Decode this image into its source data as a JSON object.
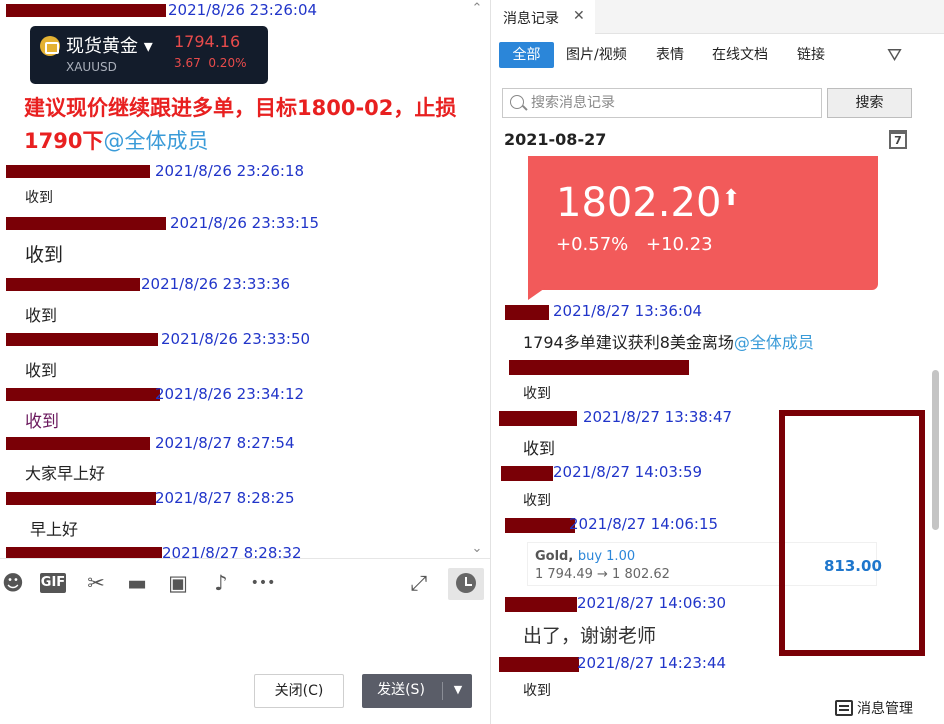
{
  "chat": {
    "timestamps": [
      "2021/8/26 23:26:04",
      "2021/8/26 23:26:18",
      "2021/8/26 23:33:15",
      "2021/8/26 23:33:36",
      "2021/8/26 23:33:50",
      "2021/8/26 23:34:12",
      "2021/8/27 8:27:54",
      "2021/8/27 8:28:25",
      "2021/8/27 8:28:32"
    ],
    "gold_card": {
      "name": "现货黄金 ▾",
      "code": "XAUUSD",
      "price": "1794.16",
      "change": "3.67",
      "change_pct": "0.20%"
    },
    "advice_text": "建议现价继续跟进多单，目标1800-02，止损1790下",
    "advice_mention": "@全体成员",
    "messages": [
      "收到",
      "收到",
      "收到",
      "收到",
      "收到",
      "大家早上好",
      "早上好"
    ]
  },
  "toolbar": {
    "icons": [
      "emoji-icon",
      "gif-icon",
      "scissors-icon",
      "folder-icon",
      "image-icon",
      "bell-icon",
      "more-icon",
      "expand-icon",
      "clock-icon"
    ],
    "gif_label": "GIF",
    "more_glyph": "•••"
  },
  "buttons": {
    "close": "关闭(C)",
    "send": "发送(S)"
  },
  "history": {
    "tab_title": "消息记录",
    "filters": [
      "全部",
      "图片/视频",
      "表情",
      "在线文档",
      "链接"
    ],
    "search_placeholder": "搜索消息记录",
    "search_button": "搜索",
    "date": "2021-08-27",
    "calendar_day": "7",
    "price_card": {
      "price": "1802.20",
      "pct": "+0.57%",
      "abs": "+10.23"
    },
    "timestamps": [
      "2021/8/27 13:36:04",
      "2021/8/27 13:38:47",
      "2021/8/27 14:03:59",
      "2021/8/27 14:06:15",
      "2021/8/27 14:06:30",
      "2021/8/27 14:23:44"
    ],
    "msg_profit": "1794多单建议获利8美金离场",
    "msg_mention": "@全体成员",
    "msgs": [
      "收到",
      "收到",
      "收到",
      "出了，谢谢老师",
      "收到"
    ],
    "trade": {
      "symbol": "Gold,",
      "side": "buy 1.00",
      "prices": "1 794.49 → 1 802.62",
      "amount": "813.00"
    },
    "manage_label": "消息管理"
  },
  "colors": {
    "link_blue": "#2135c9",
    "advice_red": "#e82020",
    "redaction": "#7a0006",
    "accent_blue": "#2b86d9",
    "card_red": "#f25a5a"
  }
}
